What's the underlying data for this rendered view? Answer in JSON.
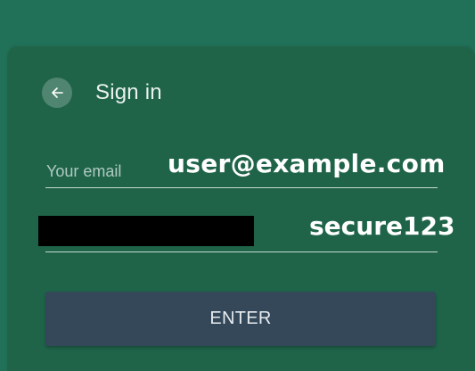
{
  "header": {
    "title": "Sign in",
    "back_icon": "arrow-left-icon"
  },
  "email_field": {
    "placeholder": "Your email",
    "value": "user@example.com"
  },
  "password_field": {
    "value": "secure123"
  },
  "enter_button": {
    "label": "ENTER"
  },
  "colors": {
    "background": "#217158",
    "card": "#1f6449",
    "button": "#34485a"
  }
}
